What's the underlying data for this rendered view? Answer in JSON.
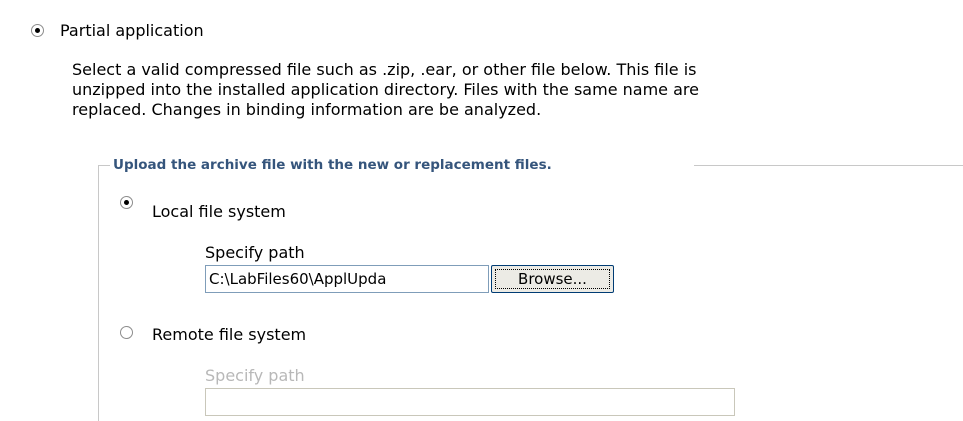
{
  "partial": {
    "label": "Partial application",
    "selected": true,
    "description": [
      "Select a valid compressed file such as .zip, .ear, or other file below. This file is",
      "unzipped into the installed application directory. Files with the same name are",
      "replaced. Changes in binding information are be analyzed."
    ]
  },
  "upload_group": {
    "legend": "Upload the archive file with the new or replacement files.",
    "local": {
      "label": "Local file system",
      "selected": true,
      "path_label": "Specify path",
      "path_value": "C:\\LabFiles60\\ApplUpda",
      "browse_label": "Browse..."
    },
    "remote": {
      "label": "Remote file system",
      "selected": false,
      "path_label": "Specify path",
      "path_value": ""
    }
  }
}
